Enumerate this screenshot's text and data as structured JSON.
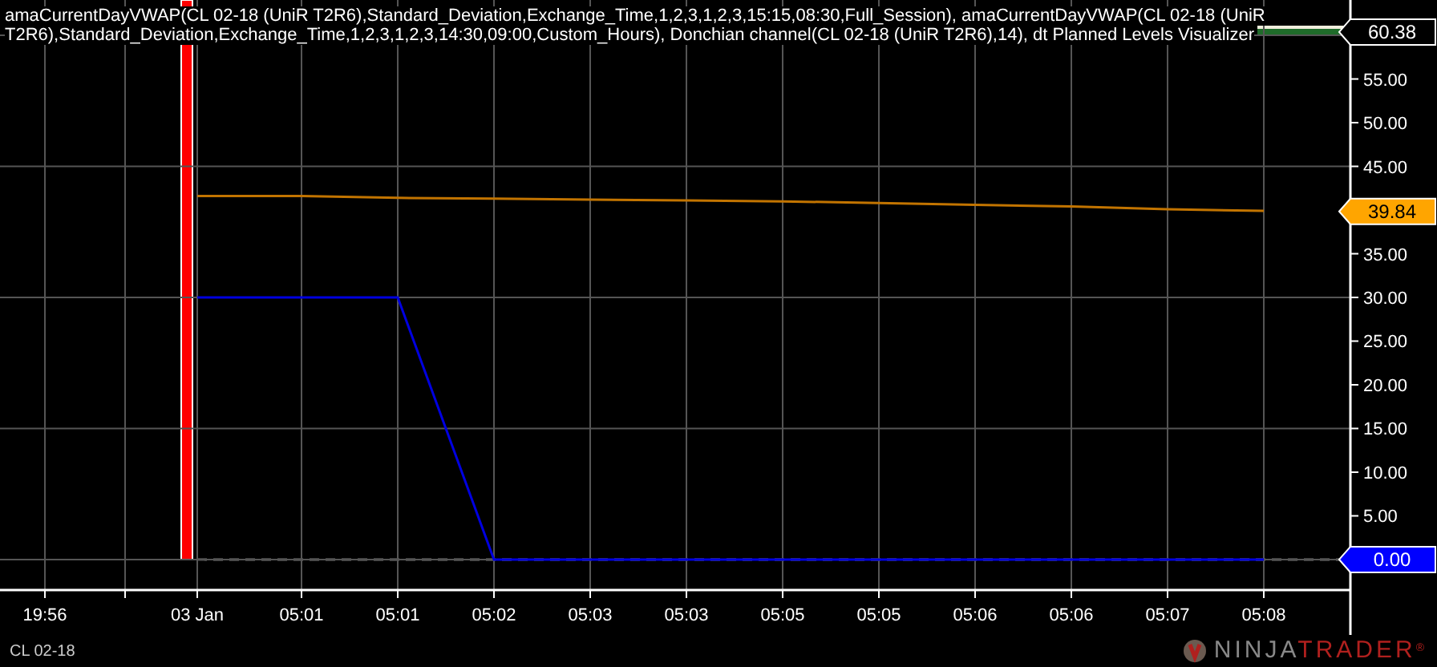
{
  "legend": {
    "lines": [
      "amaCurrentDayVWAP(CL 02-18 (UniR T2R6),Standard_Deviation,Exchange_Time,1,2,3,1,2,3,15:15,08:30,Full_Session), amaCurrentDayVWAP(CL 02-18 (UniR",
      "T2R6),Standard_Deviation,Exchange_Time,1,2,3,1,2,3,14:30,09:00,Custom_Hours), Donchian channel(CL 02-18 (UniR T2R6),14), dt Planned Levels Visualizer"
    ]
  },
  "chart": {
    "chart_data": {
      "type": "line",
      "categories": [
        "19:56",
        "03 Jan",
        "05:01",
        "05:01",
        "05:02",
        "05:03",
        "05:03",
        "05:05",
        "05:05",
        "05:06",
        "05:06",
        "05:07",
        "05:08"
      ],
      "ylim": [
        -3.49,
        64.04
      ],
      "grid": true,
      "yticks": [
        {
          "value": 5,
          "label": "5.00"
        },
        {
          "value": 10,
          "label": "10.00"
        },
        {
          "value": 15,
          "label": "15.00"
        },
        {
          "value": 20,
          "label": "20.00"
        },
        {
          "value": 25,
          "label": "25.00"
        },
        {
          "value": 30,
          "label": "30.00"
        },
        {
          "value": 35,
          "label": "35.00"
        },
        {
          "value": 45,
          "label": "45.00"
        },
        {
          "value": 50,
          "label": "50.00"
        },
        {
          "value": 55,
          "label": "55.00"
        }
      ],
      "series": [
        {
          "color": "#c27400",
          "values": [
            null,
            41.6,
            41.6,
            41.4,
            41.3,
            41.2,
            41.1,
            41.0,
            40.8,
            40.6,
            40.4,
            40.1,
            39.9
          ]
        },
        {
          "color": "#0000e0",
          "values": [
            null,
            30,
            30,
            30,
            0,
            0,
            0,
            0,
            0,
            0,
            0,
            0,
            0
          ]
        }
      ]
    },
    "price_markers": [
      {
        "label": "60.38",
        "color": "#000000"
      },
      {
        "label": "39.84",
        "color": "#ffa500"
      },
      {
        "label": "0.00",
        "color": "#0000ff"
      }
    ]
  },
  "instrument": "CL 02-18",
  "logo": {
    "part_1": "NINJA",
    "part_2": "TRADER",
    "mark": "®"
  }
}
